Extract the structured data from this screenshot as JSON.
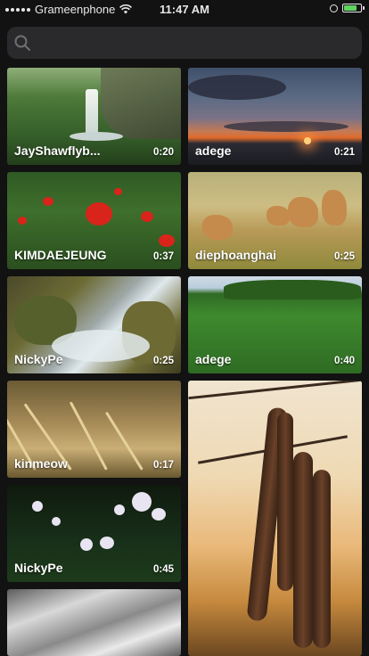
{
  "status_bar": {
    "carrier": "Grameenphone",
    "time": "11:47 AM",
    "battery_percent": 80,
    "battery_color": "#5fd45f"
  },
  "search": {
    "placeholder": "",
    "value": "",
    "icon": "search-icon"
  },
  "videos": [
    {
      "author": "JayShawflyb...",
      "duration": "0:20"
    },
    {
      "author": "adege",
      "duration": "0:21"
    },
    {
      "author": "KIMDAEJEUNG",
      "duration": "0:37"
    },
    {
      "author": "diephoanghai",
      "duration": "0:25"
    },
    {
      "author": "NickyPe",
      "duration": "0:25"
    },
    {
      "author": "adege",
      "duration": "0:40"
    },
    {
      "author": "kinmeow",
      "duration": "0:17"
    },
    {
      "author": "NickyPe",
      "duration": "0:45"
    },
    {
      "author": "",
      "duration": ""
    },
    {
      "author": "",
      "duration": ""
    }
  ]
}
